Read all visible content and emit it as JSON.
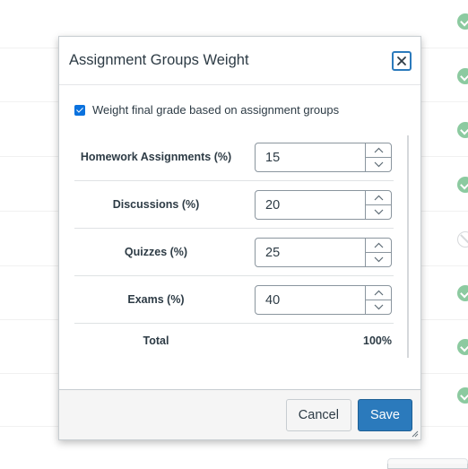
{
  "dialog": {
    "title": "Assignment Groups Weight",
    "close_icon": "close-icon"
  },
  "weight_option": {
    "label": "Weight final grade based on assignment groups",
    "checked": true
  },
  "groups": [
    {
      "name": "Homework Assignments (%)",
      "value": "15"
    },
    {
      "name": "Discussions (%)",
      "value": "20"
    },
    {
      "name": "Quizzes (%)",
      "value": "25"
    },
    {
      "name": "Exams (%)",
      "value": "40"
    }
  ],
  "total": {
    "label": "Total",
    "value": "100%"
  },
  "footer": {
    "cancel_label": "Cancel",
    "save_label": "Save"
  },
  "background": {
    "row_statuses": [
      "check",
      "check",
      "check",
      "check",
      "none",
      "check",
      "check",
      "check"
    ]
  },
  "colors": {
    "accent": "#2b7abc",
    "checkbox": "#0b72de",
    "success": "#2e9e52",
    "text": "#2d3b45"
  }
}
